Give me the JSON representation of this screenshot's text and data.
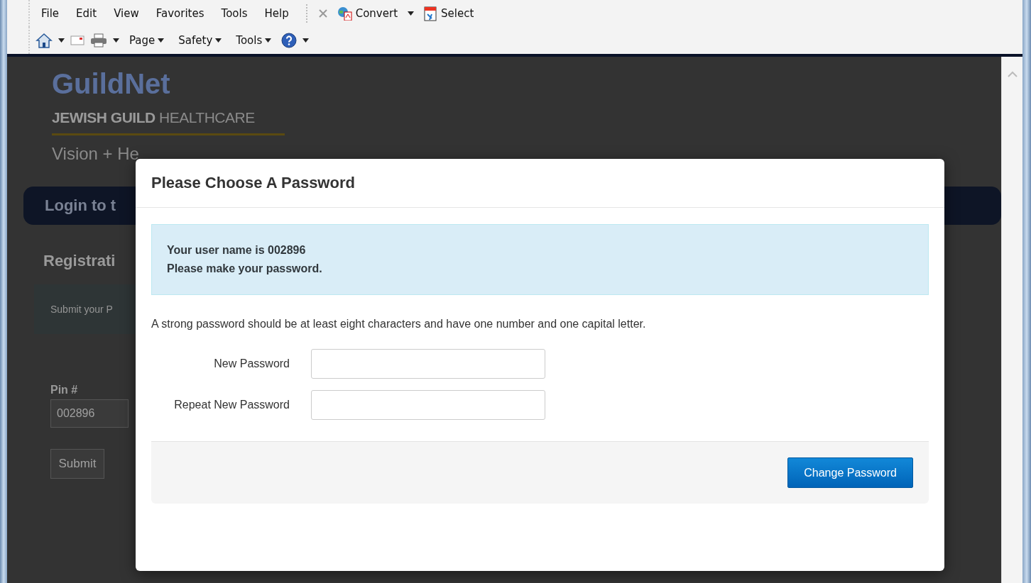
{
  "menu_bar": {
    "items": [
      "File",
      "Edit",
      "View",
      "Favorites",
      "Tools",
      "Help"
    ],
    "convert": "Convert",
    "select": "Select"
  },
  "command_bar": {
    "items": [
      "Page",
      "Safety",
      "Tools"
    ]
  },
  "background_page": {
    "logo": "GuildNet",
    "org_bold": "JEWISH GUILD",
    "org_light": "HEALTHCARE",
    "tagline": "Vision + He",
    "login_bar": "Login to t",
    "heading": "Registrati",
    "notice": "Submit your P",
    "pin_label": "Pin #",
    "pin_value": "002896",
    "submit": "Submit"
  },
  "dialog": {
    "title": "Please Choose A Password",
    "info_lines": [
      "Your user name is 002896",
      "Please make your password."
    ],
    "hint": "A strong password should be at least eight characters and have one number and one capital letter.",
    "fields": [
      {
        "label": "New Password"
      },
      {
        "label": "Repeat New Password"
      }
    ],
    "button": "Change Password"
  }
}
